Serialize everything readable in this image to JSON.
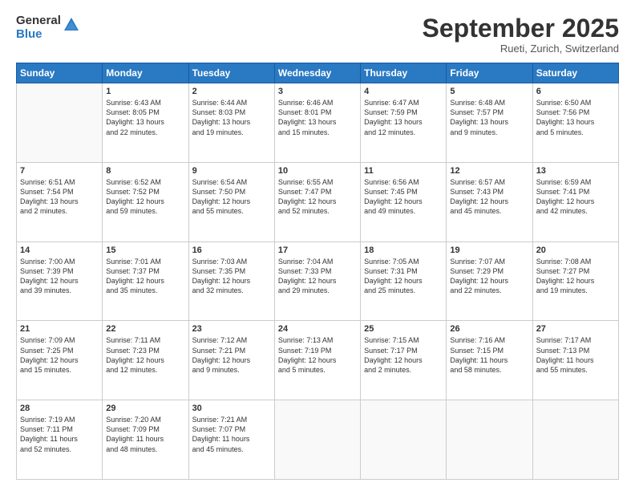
{
  "logo": {
    "general": "General",
    "blue": "Blue"
  },
  "header": {
    "month": "September 2025",
    "location": "Rueti, Zurich, Switzerland"
  },
  "weekdays": [
    "Sunday",
    "Monday",
    "Tuesday",
    "Wednesday",
    "Thursday",
    "Friday",
    "Saturday"
  ],
  "weeks": [
    [
      {
        "day": "",
        "info": ""
      },
      {
        "day": "1",
        "info": "Sunrise: 6:43 AM\nSunset: 8:05 PM\nDaylight: 13 hours\nand 22 minutes."
      },
      {
        "day": "2",
        "info": "Sunrise: 6:44 AM\nSunset: 8:03 PM\nDaylight: 13 hours\nand 19 minutes."
      },
      {
        "day": "3",
        "info": "Sunrise: 6:46 AM\nSunset: 8:01 PM\nDaylight: 13 hours\nand 15 minutes."
      },
      {
        "day": "4",
        "info": "Sunrise: 6:47 AM\nSunset: 7:59 PM\nDaylight: 13 hours\nand 12 minutes."
      },
      {
        "day": "5",
        "info": "Sunrise: 6:48 AM\nSunset: 7:57 PM\nDaylight: 13 hours\nand 9 minutes."
      },
      {
        "day": "6",
        "info": "Sunrise: 6:50 AM\nSunset: 7:56 PM\nDaylight: 13 hours\nand 5 minutes."
      }
    ],
    [
      {
        "day": "7",
        "info": "Sunrise: 6:51 AM\nSunset: 7:54 PM\nDaylight: 13 hours\nand 2 minutes."
      },
      {
        "day": "8",
        "info": "Sunrise: 6:52 AM\nSunset: 7:52 PM\nDaylight: 12 hours\nand 59 minutes."
      },
      {
        "day": "9",
        "info": "Sunrise: 6:54 AM\nSunset: 7:50 PM\nDaylight: 12 hours\nand 55 minutes."
      },
      {
        "day": "10",
        "info": "Sunrise: 6:55 AM\nSunset: 7:47 PM\nDaylight: 12 hours\nand 52 minutes."
      },
      {
        "day": "11",
        "info": "Sunrise: 6:56 AM\nSunset: 7:45 PM\nDaylight: 12 hours\nand 49 minutes."
      },
      {
        "day": "12",
        "info": "Sunrise: 6:57 AM\nSunset: 7:43 PM\nDaylight: 12 hours\nand 45 minutes."
      },
      {
        "day": "13",
        "info": "Sunrise: 6:59 AM\nSunset: 7:41 PM\nDaylight: 12 hours\nand 42 minutes."
      }
    ],
    [
      {
        "day": "14",
        "info": "Sunrise: 7:00 AM\nSunset: 7:39 PM\nDaylight: 12 hours\nand 39 minutes."
      },
      {
        "day": "15",
        "info": "Sunrise: 7:01 AM\nSunset: 7:37 PM\nDaylight: 12 hours\nand 35 minutes."
      },
      {
        "day": "16",
        "info": "Sunrise: 7:03 AM\nSunset: 7:35 PM\nDaylight: 12 hours\nand 32 minutes."
      },
      {
        "day": "17",
        "info": "Sunrise: 7:04 AM\nSunset: 7:33 PM\nDaylight: 12 hours\nand 29 minutes."
      },
      {
        "day": "18",
        "info": "Sunrise: 7:05 AM\nSunset: 7:31 PM\nDaylight: 12 hours\nand 25 minutes."
      },
      {
        "day": "19",
        "info": "Sunrise: 7:07 AM\nSunset: 7:29 PM\nDaylight: 12 hours\nand 22 minutes."
      },
      {
        "day": "20",
        "info": "Sunrise: 7:08 AM\nSunset: 7:27 PM\nDaylight: 12 hours\nand 19 minutes."
      }
    ],
    [
      {
        "day": "21",
        "info": "Sunrise: 7:09 AM\nSunset: 7:25 PM\nDaylight: 12 hours\nand 15 minutes."
      },
      {
        "day": "22",
        "info": "Sunrise: 7:11 AM\nSunset: 7:23 PM\nDaylight: 12 hours\nand 12 minutes."
      },
      {
        "day": "23",
        "info": "Sunrise: 7:12 AM\nSunset: 7:21 PM\nDaylight: 12 hours\nand 9 minutes."
      },
      {
        "day": "24",
        "info": "Sunrise: 7:13 AM\nSunset: 7:19 PM\nDaylight: 12 hours\nand 5 minutes."
      },
      {
        "day": "25",
        "info": "Sunrise: 7:15 AM\nSunset: 7:17 PM\nDaylight: 12 hours\nand 2 minutes."
      },
      {
        "day": "26",
        "info": "Sunrise: 7:16 AM\nSunset: 7:15 PM\nDaylight: 11 hours\nand 58 minutes."
      },
      {
        "day": "27",
        "info": "Sunrise: 7:17 AM\nSunset: 7:13 PM\nDaylight: 11 hours\nand 55 minutes."
      }
    ],
    [
      {
        "day": "28",
        "info": "Sunrise: 7:19 AM\nSunset: 7:11 PM\nDaylight: 11 hours\nand 52 minutes."
      },
      {
        "day": "29",
        "info": "Sunrise: 7:20 AM\nSunset: 7:09 PM\nDaylight: 11 hours\nand 48 minutes."
      },
      {
        "day": "30",
        "info": "Sunrise: 7:21 AM\nSunset: 7:07 PM\nDaylight: 11 hours\nand 45 minutes."
      },
      {
        "day": "",
        "info": ""
      },
      {
        "day": "",
        "info": ""
      },
      {
        "day": "",
        "info": ""
      },
      {
        "day": "",
        "info": ""
      }
    ]
  ]
}
